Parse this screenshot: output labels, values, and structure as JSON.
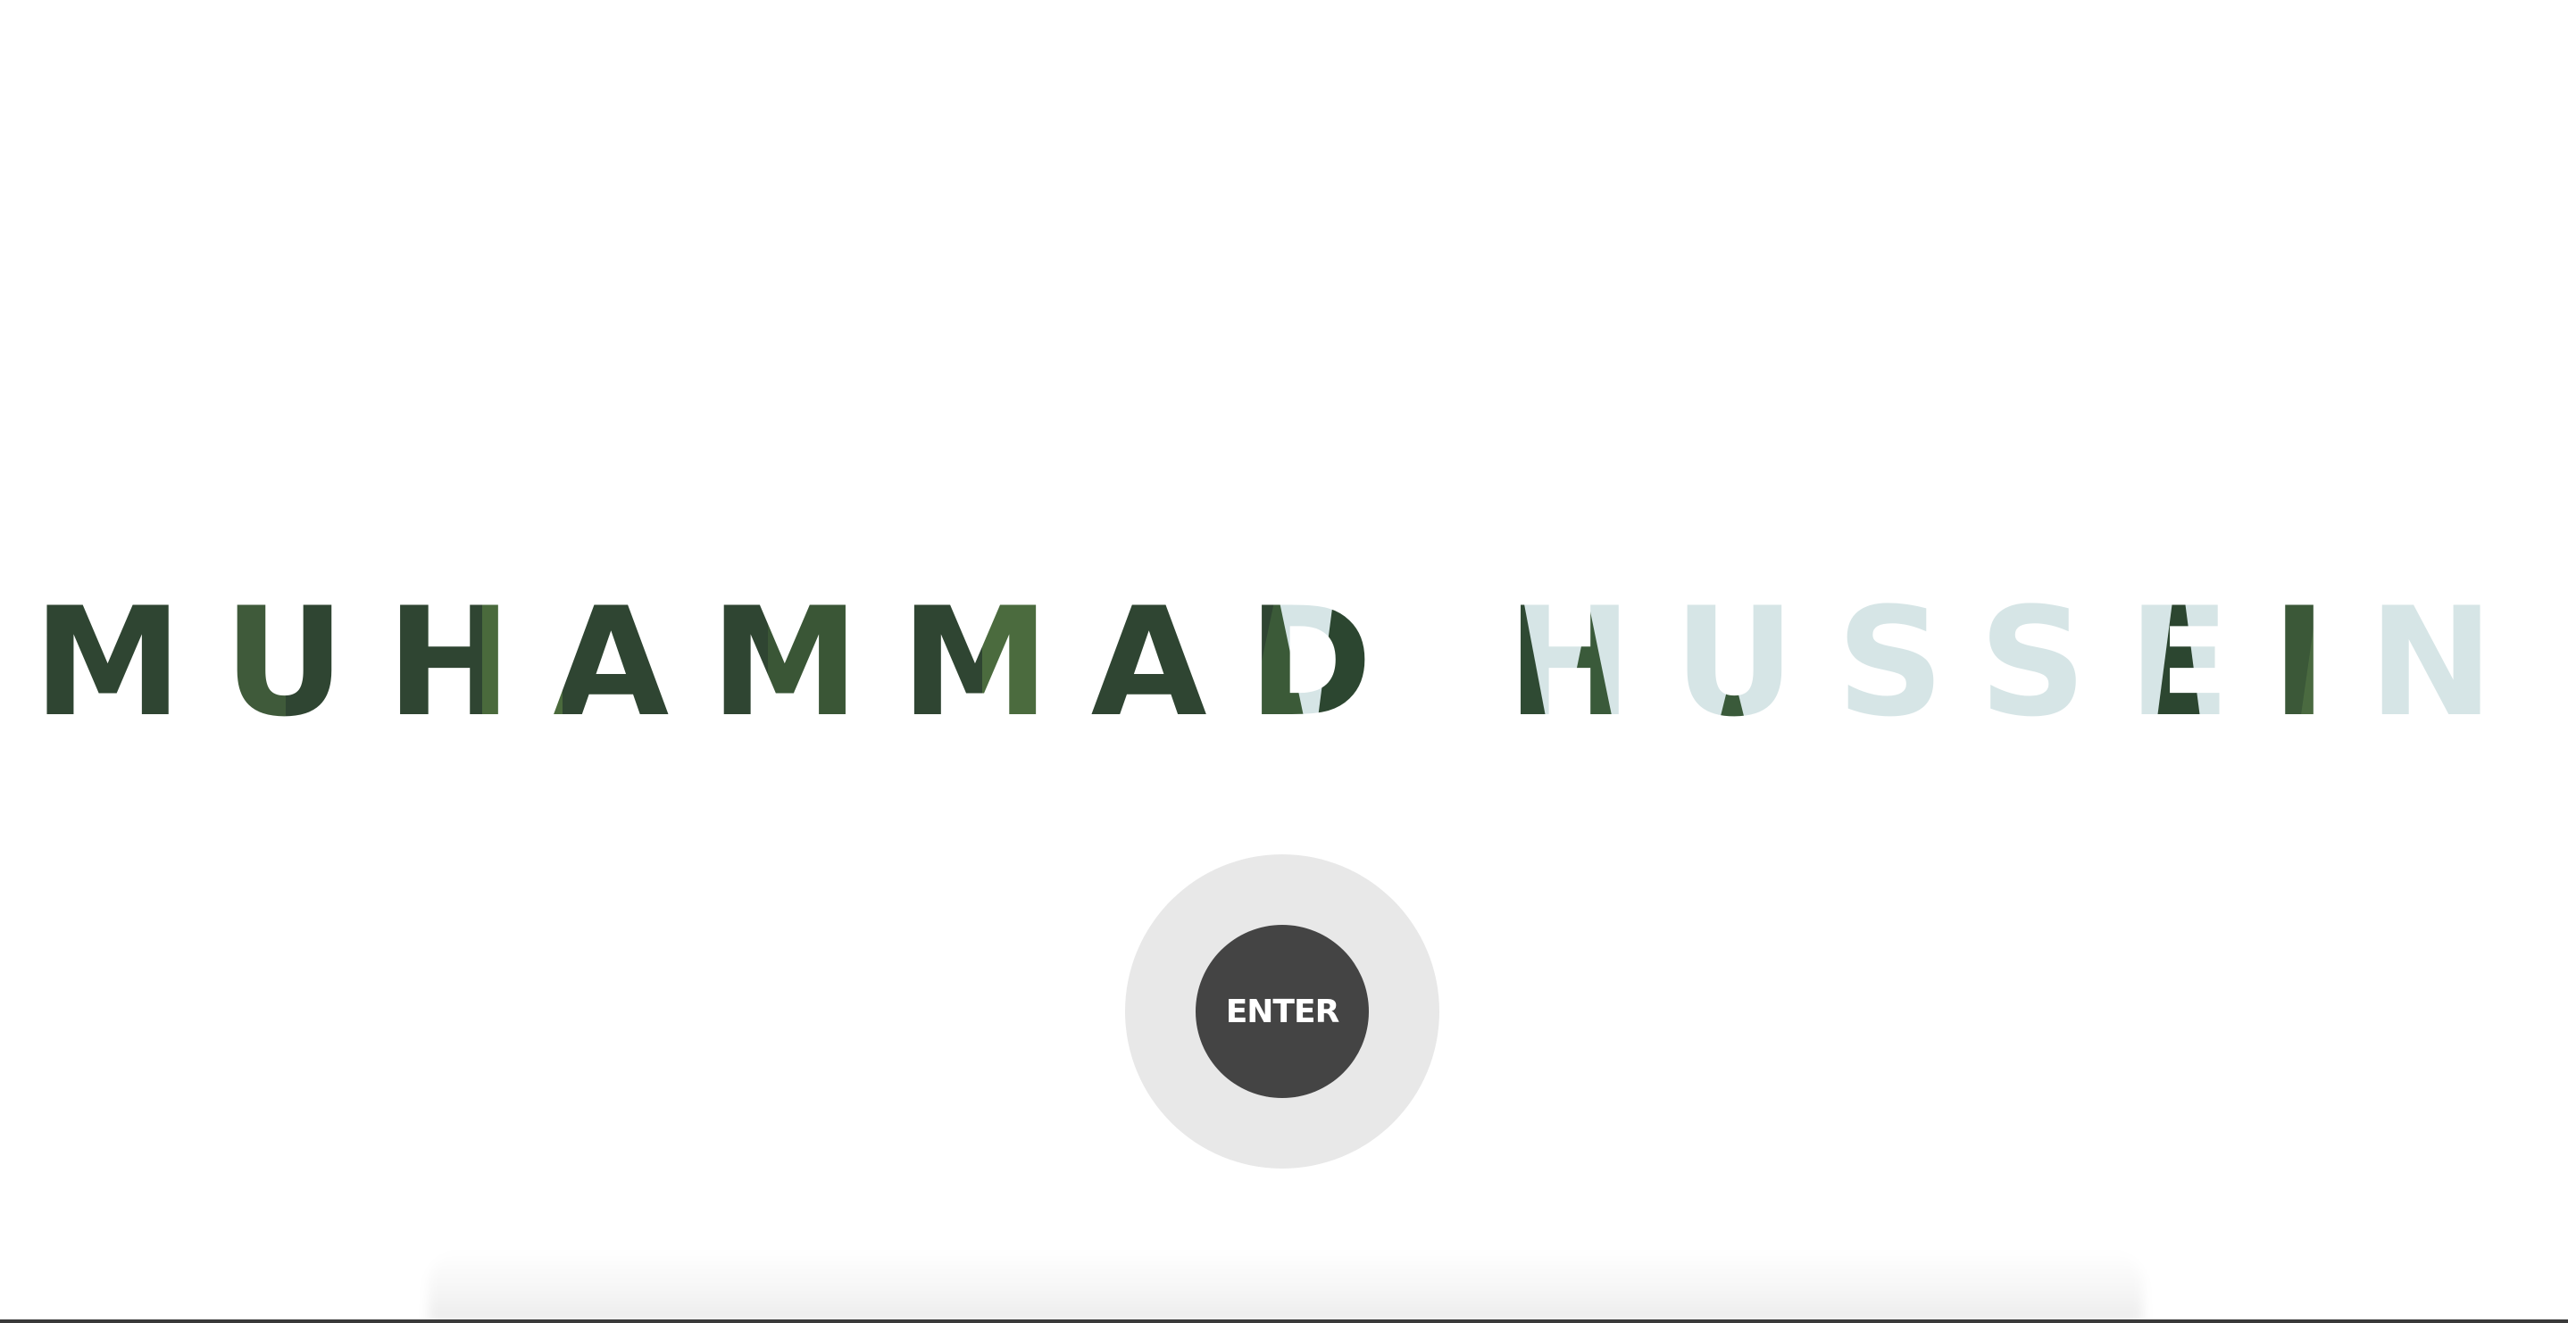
{
  "hero": {
    "title": "MUHAMMAD HUSSEIN",
    "enter_label": "ENTER"
  },
  "colors": {
    "background": "#ffffff",
    "forest_dark": "#2f4532",
    "forest_mid": "#3f5a3a",
    "sky_pale": "#d6e5e6",
    "button_fill": "#444444",
    "button_halo": "#e8e8e8",
    "button_text": "#ffffff"
  }
}
